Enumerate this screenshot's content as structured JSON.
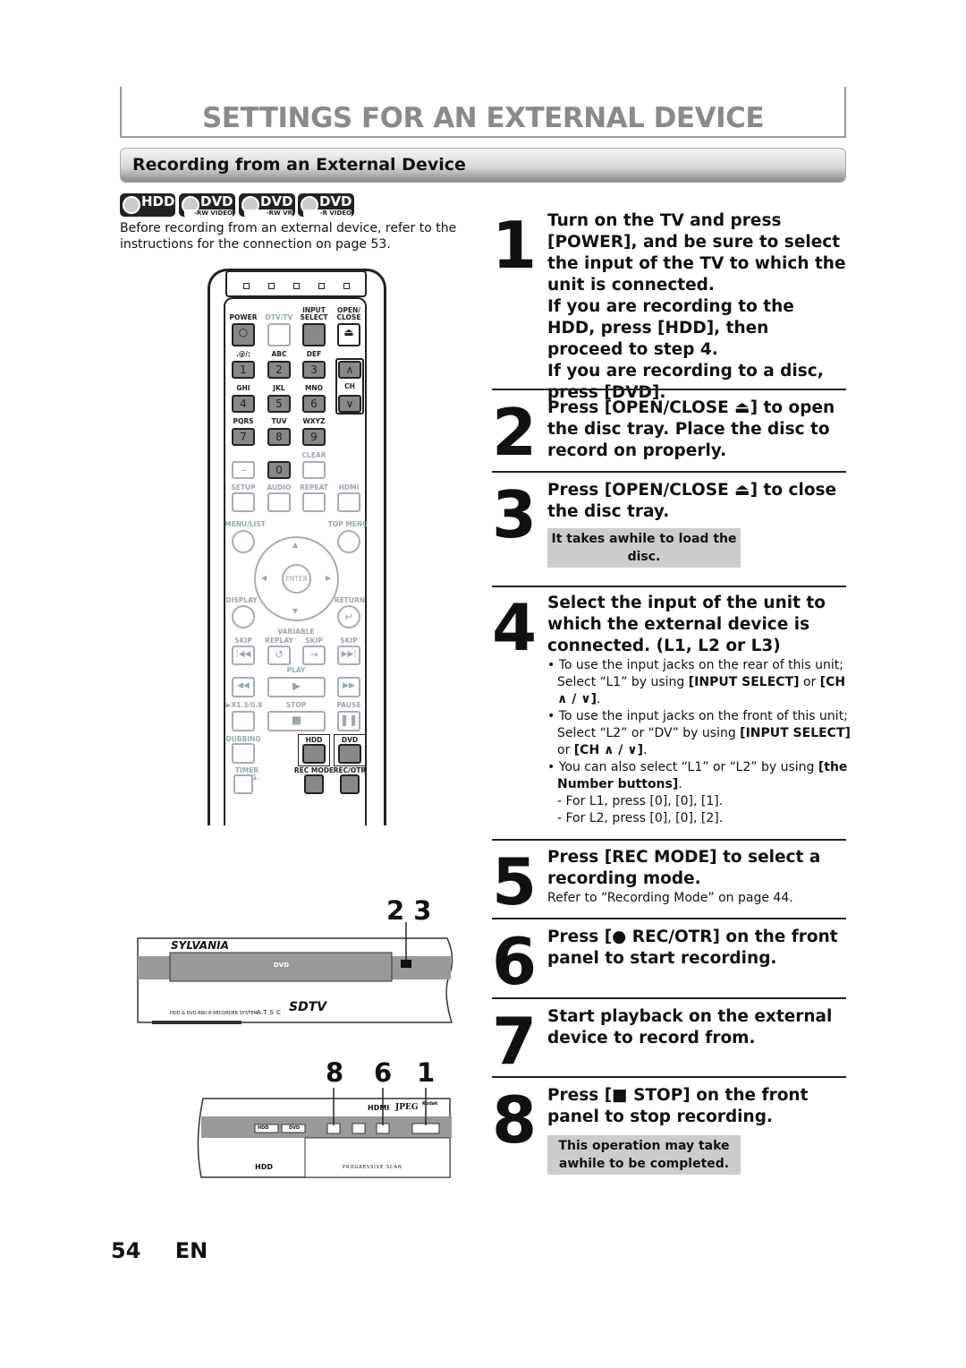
{
  "header": {
    "title": "SETTINGS FOR AN EXTERNAL DEVICE",
    "section": "Recording from an External Device"
  },
  "media_badges": [
    {
      "main": "HDD",
      "sub": ""
    },
    {
      "main": "DVD",
      "sub": "-RW VIDEO MODE"
    },
    {
      "main": "DVD",
      "sub": "-RW VR MODE"
    },
    {
      "main": "DVD",
      "sub": "-R VIDEO MODE"
    }
  ],
  "intro": "Before recording from an external device, refer to the instructions for the connection on page 53.",
  "remote": {
    "labels": {
      "power": "POWER",
      "dtvtv": "DTV/TV",
      "input_select": "INPUT SELECT",
      "open_close": "OPEN/ CLOSE",
      "k1": ".@/:",
      "k2": "ABC",
      "k3": "DEF",
      "k4": "GHI",
      "k5": "JKL",
      "k6": "MNO",
      "k7": "PQRS",
      "k8": "TUV",
      "k9": "WXYZ",
      "ch": "CH",
      "clear": "CLEAR",
      "setup": "SETUP",
      "audio": "AUDIO",
      "repeat": "REPEAT",
      "hdmi": "HDMI",
      "menu_list": "MENU/LIST",
      "top_menu": "TOP MENU",
      "enter": "ENTER",
      "display": "DISPLAY",
      "return": "RETURN",
      "variable": "VARIABLE",
      "skip_back": "SKIP",
      "replay": "REPLAY",
      "skip_var": "SKIP",
      "skip_fwd": "SKIP",
      "play": "PLAY",
      "speed": "▶X1.3/0.8",
      "stop": "STOP",
      "pause": "PAUSE",
      "dubbing": "DUBBING",
      "hdd": "HDD",
      "dvd": "DVD",
      "timer_prog": "TIMER PROG.",
      "rec_mode": "REC MODE",
      "rec_otr": "REC/OTR"
    },
    "digits": [
      "1",
      "2",
      "3",
      "4",
      "5",
      "6",
      "7",
      "8",
      "9",
      "0",
      "–"
    ]
  },
  "device1": {
    "brand": "SYLVANIA",
    "callout": "2 3",
    "model_text": "HDD & DVD-RW/-R RECORDER SYSTEM",
    "atsc": "ATSC",
    "sdtv": "SDTV",
    "disc_logo": "DVD"
  },
  "device2": {
    "callouts": [
      "8",
      "6",
      "1"
    ],
    "buttons": [
      "HDD",
      "DVD"
    ],
    "logos": [
      "HDMI",
      "JPEG",
      "Kodak"
    ],
    "progressive": "PROGRESSIVE SCAN",
    "hdd_logo": "HDD"
  },
  "steps": [
    {
      "num": "1",
      "text": "Turn on the TV and press [POWER], and be sure to select the input of the TV to which the unit is connected.",
      "text2": "If you are recording to the HDD, press [HDD], then proceed to step 4.",
      "text3": "If you are recording to a disc, press [DVD]."
    },
    {
      "num": "2",
      "text": "Press [OPEN/CLOSE ⏏] to open the disc tray. Place the disc to record on properly."
    },
    {
      "num": "3",
      "text": "Press [OPEN/CLOSE ⏏] to close the disc tray.",
      "note": "It takes awhile to load the disc."
    },
    {
      "num": "4",
      "text": "Select the input of the unit to which the external device is connected. (L1, L2 or L3)",
      "bullets": [
        {
          "pre": "To use the input jacks on the rear of this unit; Select “L1” by using ",
          "b1": "[INPUT SELECT]",
          "mid": " or ",
          "b2": "[CH ∧ / ∨]",
          "post": "."
        },
        {
          "pre": "To use the input jacks on the front of this unit; Select “L2” or “DV” by using ",
          "b1": "[INPUT SELECT]",
          "mid": " or ",
          "b2": "[CH ∧ / ∨]",
          "post": "."
        },
        {
          "pre": "You can also select “L1” or “L2” by using ",
          "b1": "[the Number buttons]",
          "mid": "",
          "b2": "",
          "post": "."
        }
      ],
      "sub": [
        "- For L1, press [0], [0], [1].",
        "- For L2, press [0], [0], [2]."
      ]
    },
    {
      "num": "5",
      "text": "Press [REC MODE] to select a recording mode.",
      "ref": "Refer to “Recording Mode” on page 44."
    },
    {
      "num": "6",
      "text": "Press [● REC/OTR] on the front panel to start recording."
    },
    {
      "num": "7",
      "text": "Start playback on the external device to record from."
    },
    {
      "num": "8",
      "text": "Press [■ STOP] on the front panel to stop recording.",
      "note": "This operation may take awhile to be completed."
    }
  ],
  "footer": {
    "page": "54",
    "lang": "EN"
  }
}
